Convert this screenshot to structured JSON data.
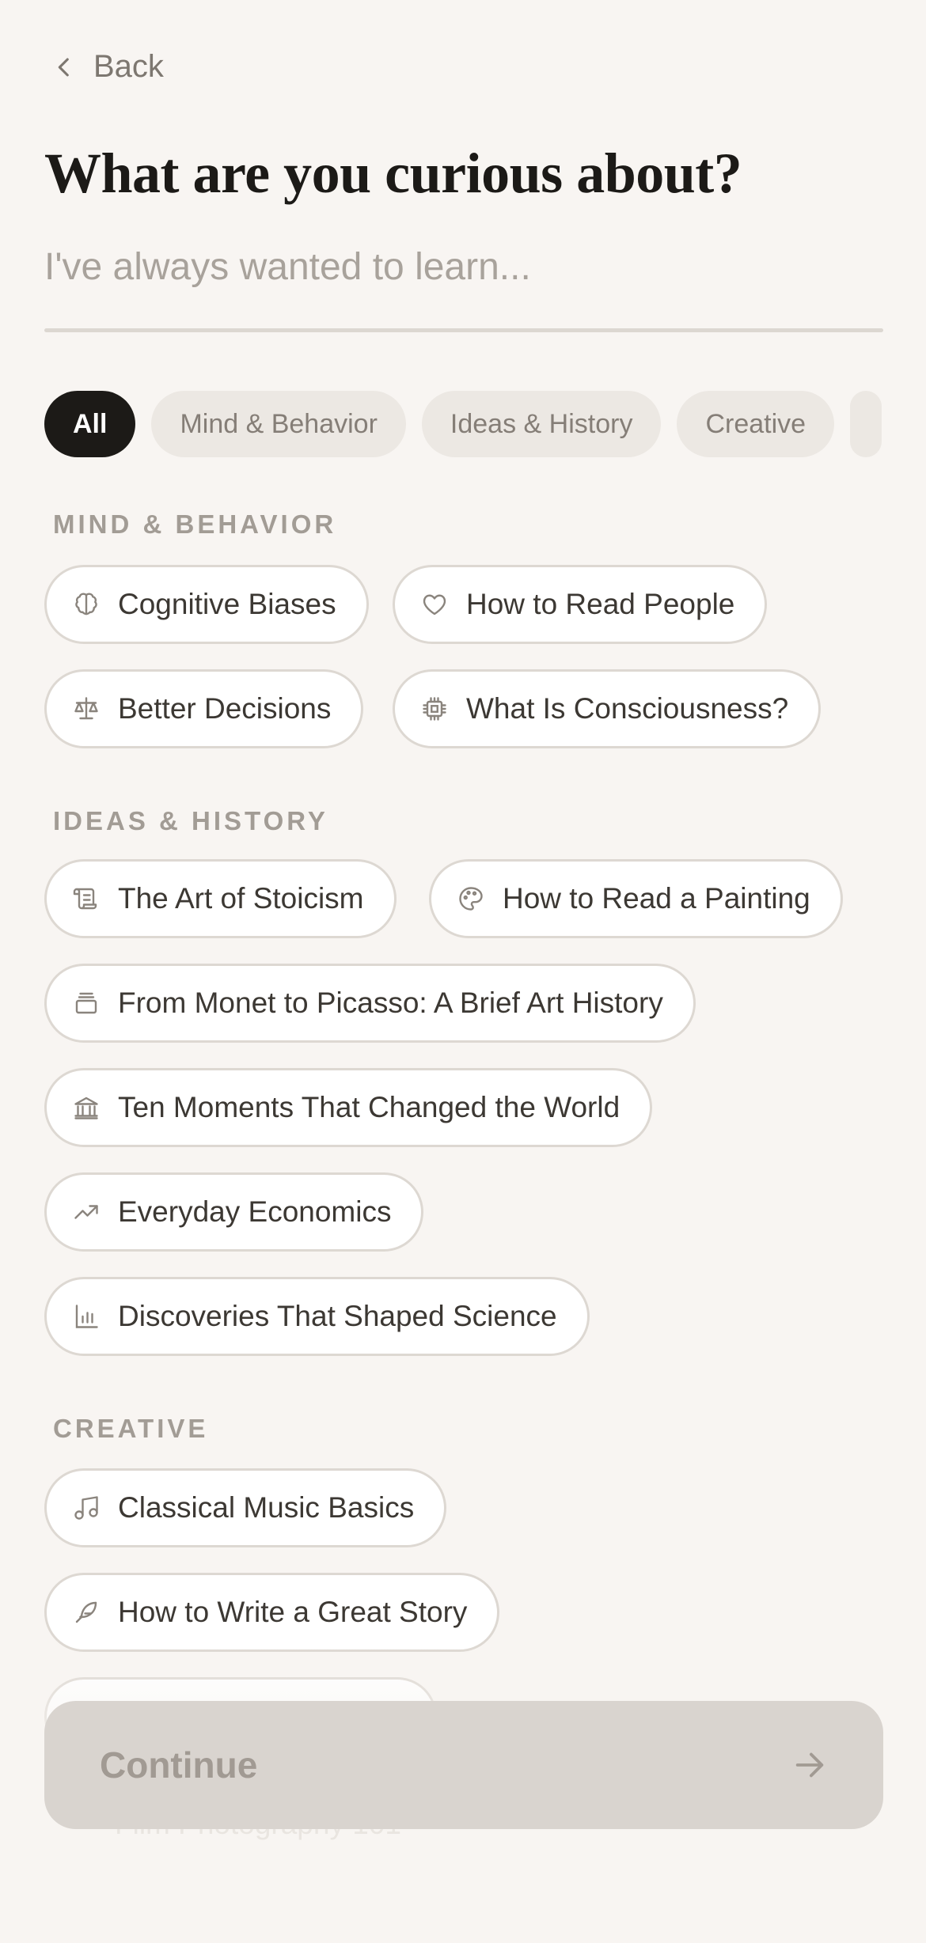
{
  "header": {
    "back_label": "Back",
    "title": "What are you curious about?"
  },
  "search": {
    "placeholder": "I've always wanted to learn..."
  },
  "filters": [
    {
      "label": "All",
      "active": true
    },
    {
      "label": "Mind & Behavior"
    },
    {
      "label": "Ideas & History"
    },
    {
      "label": "Creative"
    }
  ],
  "sections": {
    "mind": {
      "label": "MIND & BEHAVIOR",
      "topics": [
        {
          "label": "Cognitive Biases",
          "icon": "brain-icon"
        },
        {
          "label": "How to Read People",
          "icon": "heart-icon"
        },
        {
          "label": "Better Decisions",
          "icon": "scale-icon"
        },
        {
          "label": "What Is Consciousness?",
          "icon": "chip-icon"
        }
      ]
    },
    "ideas": {
      "label": "IDEAS & HISTORY",
      "topics": [
        {
          "label": "The Art of Stoicism",
          "icon": "scroll-icon"
        },
        {
          "label": "How to Read a Painting",
          "icon": "palette-icon"
        },
        {
          "label": "From Monet to Picasso: A Brief Art History",
          "icon": "frame-icon"
        },
        {
          "label": "Ten Moments That Changed the World",
          "icon": "landmark-icon"
        },
        {
          "label": "Everyday Economics",
          "icon": "trending-up-icon"
        },
        {
          "label": "Discoveries That Shaped Science",
          "icon": "bar-chart-icon"
        }
      ]
    },
    "creative": {
      "label": "CREATIVE",
      "topics": [
        {
          "label": "Classical Music Basics",
          "icon": "music-icon"
        },
        {
          "label": "How to Write a Great Story",
          "icon": "feather-icon"
        },
        {
          "label": "Film Photography 101",
          "icon": "camera-icon"
        }
      ]
    }
  },
  "footer": {
    "continue_label": "Continue",
    "continue_icon": "arrow-right-icon"
  },
  "colors": {
    "background": "#f8f5f2",
    "active_pill": "#1c1a17",
    "button_disabled": "#d9d4cf"
  }
}
